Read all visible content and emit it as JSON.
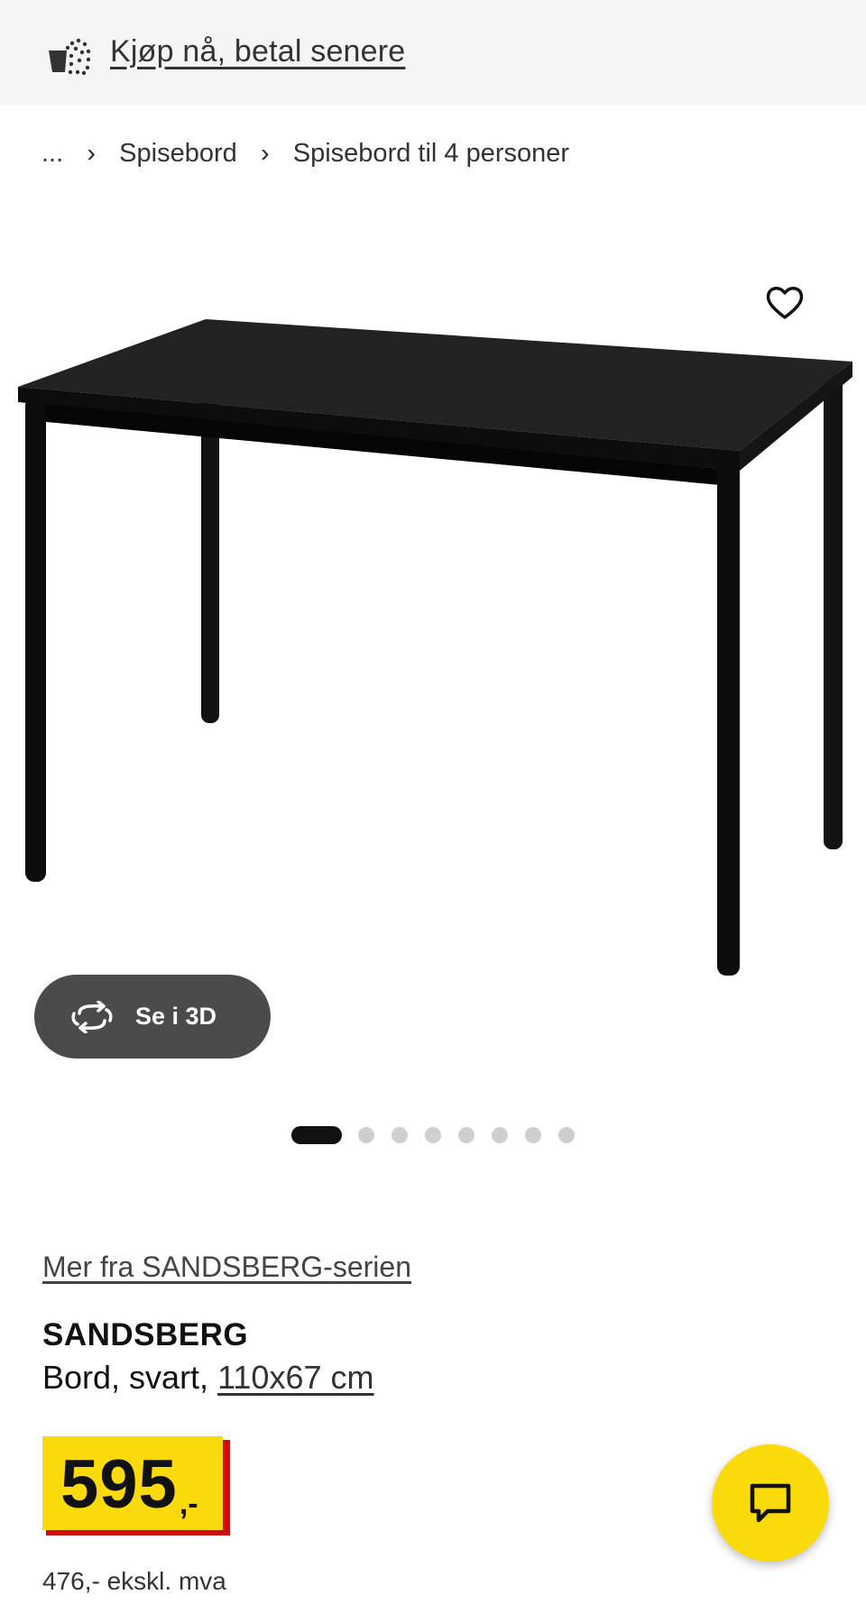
{
  "banner": {
    "label": "Kjøp nå, betal senere"
  },
  "breadcrumb": {
    "items": [
      "...",
      "Spisebord",
      "Spisebord til 4 personer"
    ],
    "separator": "›"
  },
  "gallery": {
    "view_3d_label": "Se i 3D",
    "page_count": 8,
    "current_page": 1
  },
  "product": {
    "series_link": "Mer fra SANDSBERG-serien",
    "name": "SANDSBERG",
    "description": "Bord, svart, ",
    "dimensions": "110x67 cm",
    "price": "595",
    "price_suffix": ",-",
    "price_ex_vat": "476,- ekskl. mva"
  },
  "colors": {
    "price_yellow": "#fbda0c",
    "price_red": "#d00b0b",
    "banner_bg": "#f5f5f5",
    "button_3d_bg": "#4b4b4b"
  },
  "icons": {
    "banner": "bnpl-bag-icon",
    "favourite": "heart-icon",
    "view_3d": "rotate-3d-icon",
    "chat": "chat-bubble-icon"
  }
}
